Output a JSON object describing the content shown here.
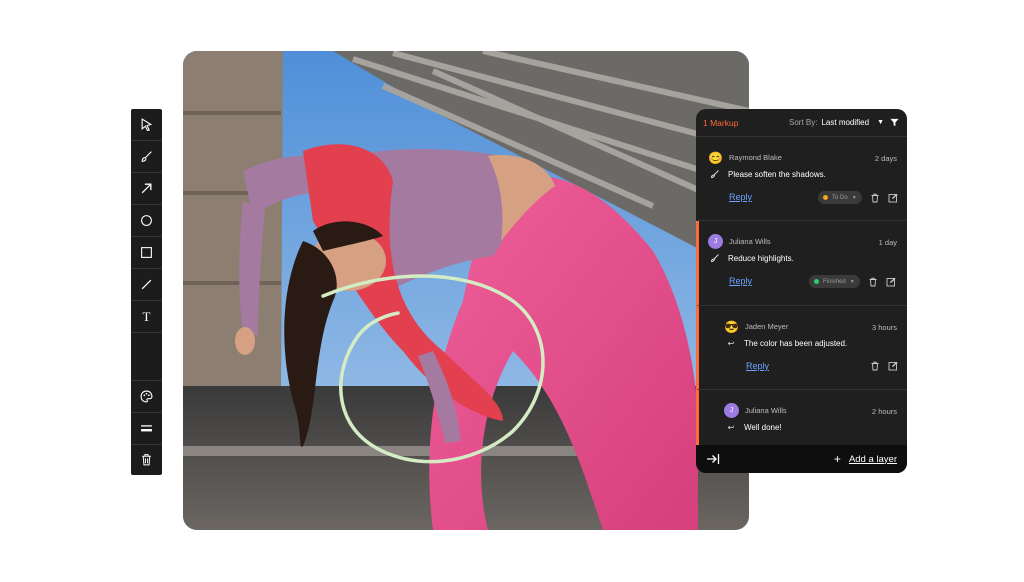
{
  "toolbar": {
    "tools": [
      {
        "name": "select-arrow-icon"
      },
      {
        "name": "brush-icon"
      },
      {
        "name": "arrow-tool-icon"
      },
      {
        "name": "circle-tool-icon"
      },
      {
        "name": "rectangle-tool-icon"
      },
      {
        "name": "line-tool-icon"
      },
      {
        "name": "text-tool-icon",
        "label": "T"
      },
      {
        "name": "palette-icon"
      },
      {
        "name": "stroke-width-icon"
      },
      {
        "name": "trash-icon"
      }
    ]
  },
  "panel": {
    "markup_count": "1 Markup",
    "sort_label": "Sort By:",
    "sort_value": "Last modified",
    "comments": [
      {
        "author": "Raymond Blake",
        "time": "2 days",
        "text": "Please soften the shadows.",
        "reply": "Reply",
        "status": "To Do",
        "status_color": "#f5a623",
        "avatar": "😊",
        "avatar_type": "emoji"
      },
      {
        "author": "Juliana Wills",
        "time": "1 day",
        "text": "Reduce highlights.",
        "reply": "Reply",
        "status": "Finished",
        "status_color": "#2ecc71",
        "avatar": "J",
        "avatar_type": "initial"
      },
      {
        "author": "Jaden Meyer",
        "time": "3 hours",
        "text": "The color has been adjusted.",
        "reply": "Reply",
        "avatar": "😎",
        "avatar_type": "emoji"
      },
      {
        "author": "Juliana Wills",
        "time": "2 hours",
        "text": "Well done!",
        "avatar": "J",
        "avatar_type": "initial"
      }
    ],
    "footer": {
      "add_layer": "Add a layer",
      "plus": "+"
    }
  },
  "colors": {
    "accent": "#ff6a3d",
    "link": "#6aa4ff",
    "panel_bg": "#1f1f1f",
    "annotation_stroke": "#d4ecc4"
  }
}
